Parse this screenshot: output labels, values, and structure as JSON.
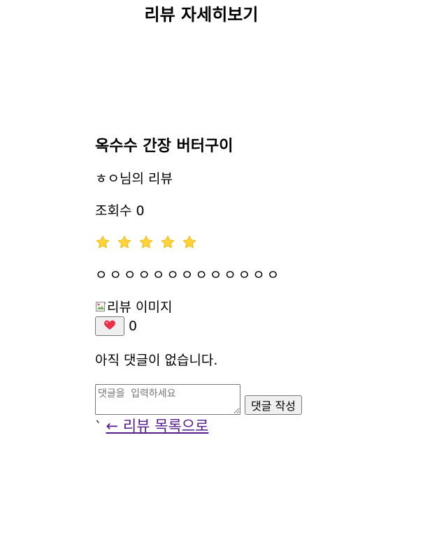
{
  "header": {
    "title": "리뷰 자세히보기"
  },
  "review": {
    "title": "옥수수 간장 버터구이",
    "author_line": "ㅎㅇ님의 리뷰",
    "views_label": "조회수",
    "views_count": "0",
    "rating": 5,
    "rating_max": 5,
    "star_color": "#ffd43b",
    "body": "ㅇㅇㅇㅇㅇㅇㅇㅇㅇㅇㅇㅇㅇ",
    "image_alt": "리뷰 이미지"
  },
  "like": {
    "icon": "heart-icon",
    "count": "0"
  },
  "comments": {
    "empty_text": "아직 댓글이 없습니다.",
    "input_placeholder": "댓글을 입력하세요",
    "input_value": "",
    "submit_label": "댓글 작성"
  },
  "footer": {
    "stray_char": "`",
    "back_link_label": "← 리뷰 목록으로"
  }
}
